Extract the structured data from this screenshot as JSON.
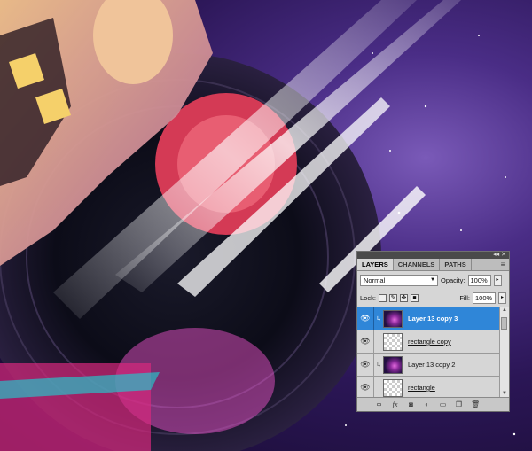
{
  "panel": {
    "tabs": [
      {
        "label": "LAYERS",
        "active": true
      },
      {
        "label": "CHANNELS",
        "active": false
      },
      {
        "label": "PATHS",
        "active": false
      }
    ],
    "blend_mode": "Normal",
    "opacity_label": "Opacity:",
    "opacity_value": "100%",
    "lock_label": "Lock:",
    "fill_label": "Fill:",
    "fill_value": "100%",
    "layers": [
      {
        "name": "Layer 13 copy 3",
        "selected": true,
        "thumb": "image",
        "clipped": true
      },
      {
        "name": "rectangle copy",
        "selected": false,
        "thumb": "transparent",
        "clipped": false
      },
      {
        "name": "Layer 13 copy 2",
        "selected": false,
        "thumb": "image",
        "clipped": true
      },
      {
        "name": "rectangle",
        "selected": false,
        "thumb": "transparent",
        "clipped": false
      }
    ],
    "icons": [
      "link-icon",
      "fx-icon",
      "mask-icon",
      "adjustment-icon",
      "folder-icon",
      "new-layer-icon",
      "trash-icon"
    ]
  },
  "colors": {
    "selection": "#2f86d8",
    "panel_bg": "#d6d6d6",
    "artwork_bg": "#2b1656"
  }
}
